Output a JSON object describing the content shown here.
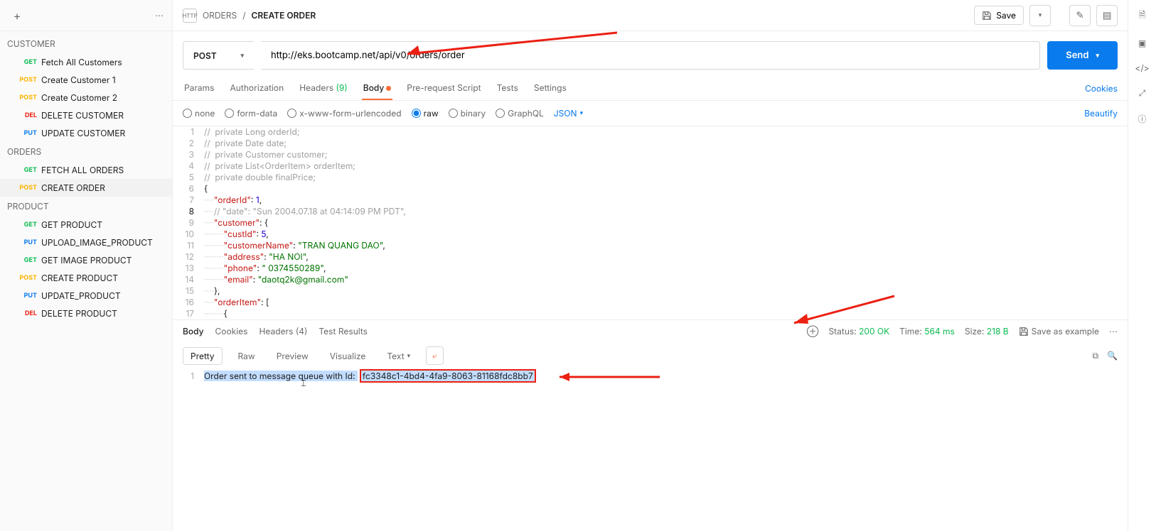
{
  "sidebar": {
    "groups": [
      {
        "label": "CUSTOMER",
        "items": [
          {
            "method": "GET",
            "mcls": "m-get",
            "label": "Fetch All Customers"
          },
          {
            "method": "POST",
            "mcls": "m-post",
            "label": "Create Customer 1"
          },
          {
            "method": "POST",
            "mcls": "m-post",
            "label": "Create Customer 2"
          },
          {
            "method": "DEL",
            "mcls": "m-del",
            "label": "DELETE CUSTOMER"
          },
          {
            "method": "PUT",
            "mcls": "m-put",
            "label": "UPDATE CUSTOMER"
          }
        ]
      },
      {
        "label": "ORDERS",
        "items": [
          {
            "method": "GET",
            "mcls": "m-get",
            "label": "FETCH ALL ORDERS"
          },
          {
            "method": "POST",
            "mcls": "m-post",
            "label": "CREATE ORDER",
            "sel": true
          }
        ]
      },
      {
        "label": "PRODUCT",
        "items": [
          {
            "method": "GET",
            "mcls": "m-get",
            "label": "GET PRODUCT"
          },
          {
            "method": "PUT",
            "mcls": "m-put",
            "label": "UPLOAD_IMAGE_PRODUCT"
          },
          {
            "method": "GET",
            "mcls": "m-get",
            "label": "GET IMAGE PRODUCT"
          },
          {
            "method": "POST",
            "mcls": "m-post",
            "label": "CREATE PRODUCT"
          },
          {
            "method": "PUT",
            "mcls": "m-put",
            "label": "UPDATE_PRODUCT"
          },
          {
            "method": "DEL",
            "mcls": "m-del",
            "label": "DELETE PRODUCT"
          }
        ]
      }
    ]
  },
  "crumb": {
    "icon": "HTTP",
    "parent": "ORDERS",
    "sep": "/",
    "current": "CREATE ORDER",
    "save": "Save"
  },
  "request": {
    "method": "POST",
    "url": "http://eks.bootcamp.net/api/v0/orders/order",
    "send": "Send"
  },
  "tabs": {
    "params": "Params",
    "auth": "Authorization",
    "headers": "Headers",
    "headers_count": "(9)",
    "body": "Body",
    "pre": "Pre-request Script",
    "tests": "Tests",
    "settings": "Settings",
    "cookies": "Cookies"
  },
  "body_opts": {
    "none": "none",
    "formdata": "form-data",
    "xwww": "x-www-form-urlencoded",
    "raw": "raw",
    "binary": "binary",
    "graphql": "GraphQL",
    "json": "JSON",
    "beautify": "Beautify"
  },
  "editor": [
    {
      "n": 1,
      "html": "<span class='cmt'>//  private Long orderId;</span>"
    },
    {
      "n": 2,
      "html": "<span class='cmt'>//  private Date date;</span>"
    },
    {
      "n": 3,
      "html": "<span class='cmt'>//  private Customer customer;</span>"
    },
    {
      "n": 4,
      "html": "<span class='cmt'>//  private List&lt;OrderItem&gt; orderItem;</span>"
    },
    {
      "n": 5,
      "html": "<span class='cmt'>//  private double finalPrice;</span>"
    },
    {
      "n": 6,
      "html": "{"
    },
    {
      "n": 7,
      "html": "<span class='guide'>····</span><span class='key'>\"orderId\"</span>: <span class='num'>1</span>,"
    },
    {
      "n": 8,
      "cur": true,
      "html": "<span class='guide'>····</span><span class='cmt'>// \"date\": \"Sun 2004.07.18 at 04:14:09 PM PDT\",</span>"
    },
    {
      "n": 9,
      "html": "<span class='guide'>····</span><span class='key'>\"customer\"</span>: {"
    },
    {
      "n": 10,
      "html": "<span class='guide'>········</span><span class='key'>\"custId\"</span>: <span class='num'>5</span>,"
    },
    {
      "n": 11,
      "html": "<span class='guide'>········</span><span class='key'>\"customerName\"</span>: <span class='str'>\"TRAN QUANG DAO\"</span>,"
    },
    {
      "n": 12,
      "html": "<span class='guide'>········</span><span class='key'>\"address\"</span>: <span class='str'>\"HA NOI\"</span>,"
    },
    {
      "n": 13,
      "html": "<span class='guide'>········</span><span class='key'>\"phone\"</span>: <span class='str'>\" 0374550289\"</span>,"
    },
    {
      "n": 14,
      "html": "<span class='guide'>········</span><span class='key'>\"email\"</span>: <span class='str'>\"daotq2k@gmail.com\"</span>"
    },
    {
      "n": 15,
      "html": "<span class='guide'>····</span>},"
    },
    {
      "n": 16,
      "html": "<span class='guide'>····</span><span class='key'>\"orderItem\"</span>: ["
    },
    {
      "n": 17,
      "html": "<span class='guide'>········</span>{"
    }
  ],
  "response": {
    "tabs": {
      "body": "Body",
      "cookies": "Cookies",
      "headers": "Headers",
      "headers_count": "(4)",
      "tests": "Test Results"
    },
    "status_lbl": "Status:",
    "status_val": "200 OK",
    "time_lbl": "Time:",
    "time_val": "564 ms",
    "size_lbl": "Size:",
    "size_val": "218 B",
    "save_ex": "Save as example",
    "fmt": {
      "pretty": "Pretty",
      "raw": "Raw",
      "preview": "Preview",
      "visualize": "Visualize",
      "text": "Text"
    },
    "line_no": "1",
    "msg": "Order sent to message queue with Id: ",
    "id": "fc3348c1-4bd4-4fa9-8063-81168fdc8bb7"
  }
}
